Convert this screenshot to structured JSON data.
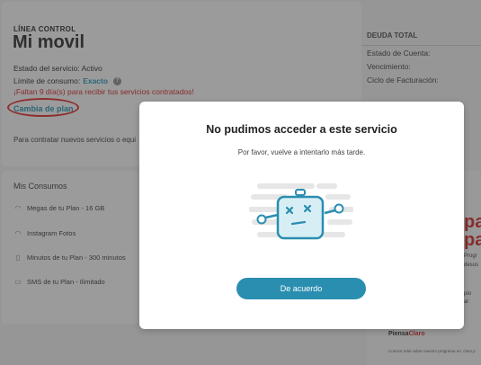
{
  "line": {
    "label": "LÍNEA CONTROL",
    "name": "Mi movil",
    "status": "Estado del servicio: Activo",
    "limit_label": "Límite de consumo:",
    "limit_value": "Exacto",
    "warning": "¡Faltan 9 día(s) para recibir tus servicios contratados!",
    "change_plan": "Cambia de plan",
    "contract_text": "Para contratar nuevos servicios o equi"
  },
  "debt": {
    "title": "DEUDA TOTAL",
    "rows": [
      "Estado de Cuenta:",
      "Vencimiento:",
      "Ciclo de Facturación:"
    ]
  },
  "consumption": {
    "title": "Mis Consumos",
    "items": [
      {
        "label": "Megas de tu Plan - 16 GB",
        "icon": "wifi-icon"
      },
      {
        "label": "Instagram Fotos",
        "icon": "wifi-icon"
      },
      {
        "label": "Minutos de tu Plan - 300 minutos",
        "icon": "phone-icon"
      },
      {
        "label": "SMS de tu Plan - Ilimitado",
        "icon": "message-icon"
      }
    ]
  },
  "ad": {
    "big1": "pa",
    "big2": "pa",
    "small": [
      "Progr",
      "desus",
      "pio",
      "al"
    ],
    "brand_1": "Piensa",
    "brand_2": "Claro",
    "footer": "Conoce más sobre nuestro programa en: claro.p"
  },
  "modal": {
    "title": "No pudimos acceder a este servicio",
    "subtitle": "Por favor, vuelve a intentarlo más tarde.",
    "button": "De acuerdo"
  },
  "colors": {
    "accent": "#2a8eb0",
    "warning": "#d41c1c"
  }
}
